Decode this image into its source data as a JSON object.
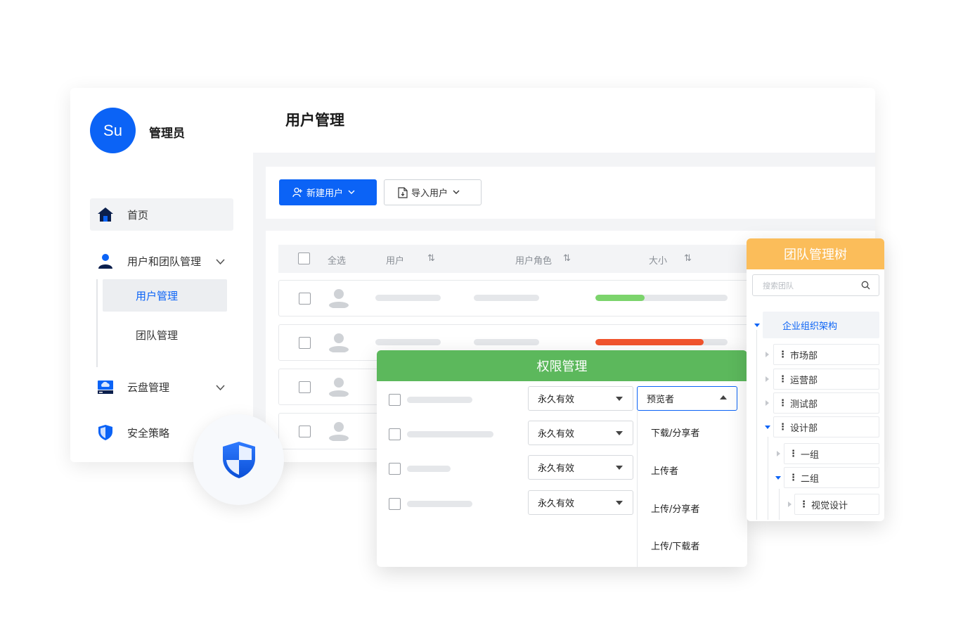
{
  "sidebar": {
    "avatar_initials": "Su",
    "admin_name": "管理员",
    "nav": {
      "home": "首页",
      "user_team": "用户和团队管理",
      "user_manage": "用户管理",
      "team_manage": "团队管理",
      "cloud": "云盘管理",
      "security": "安全策略"
    }
  },
  "main": {
    "title": "用户管理",
    "toolbar": {
      "new_user": "新建用户",
      "import_user": "导入用户"
    },
    "table": {
      "headers": {
        "select_all": "全选",
        "user": "用户",
        "role": "用户角色",
        "size": "大小",
        "sort_glyph": "⇅"
      },
      "rows": [
        {
          "usage": 0.37,
          "usage_color": "#7cd46c"
        },
        {
          "usage": 0.82,
          "usage_color": "#f2542d"
        },
        {
          "usage": 0,
          "usage_color": "#e5e7ea"
        },
        {
          "usage": 0,
          "usage_color": "#e5e7ea"
        }
      ]
    }
  },
  "permission": {
    "title": "权限管理",
    "validity": [
      "永久有效",
      "永久有效",
      "永久有效",
      "永久有效"
    ],
    "role_selected": "预览者",
    "role_options": [
      "下载/分享者",
      "上传者",
      "上传/分享者",
      "上传/下载者"
    ]
  },
  "team_tree": {
    "title": "团队管理树",
    "search_placeholder": "搜索团队",
    "root": "企业组织架构",
    "nodes": {
      "market": "市场部",
      "operation": "运营部",
      "testing": "测试部",
      "design": "设计部",
      "group1": "一组",
      "group2": "二组",
      "visual": "视觉设计"
    }
  },
  "colors": {
    "accent": "#0b63f6",
    "permission_header": "#5cb85c",
    "tree_header": "#fbbd5a"
  }
}
